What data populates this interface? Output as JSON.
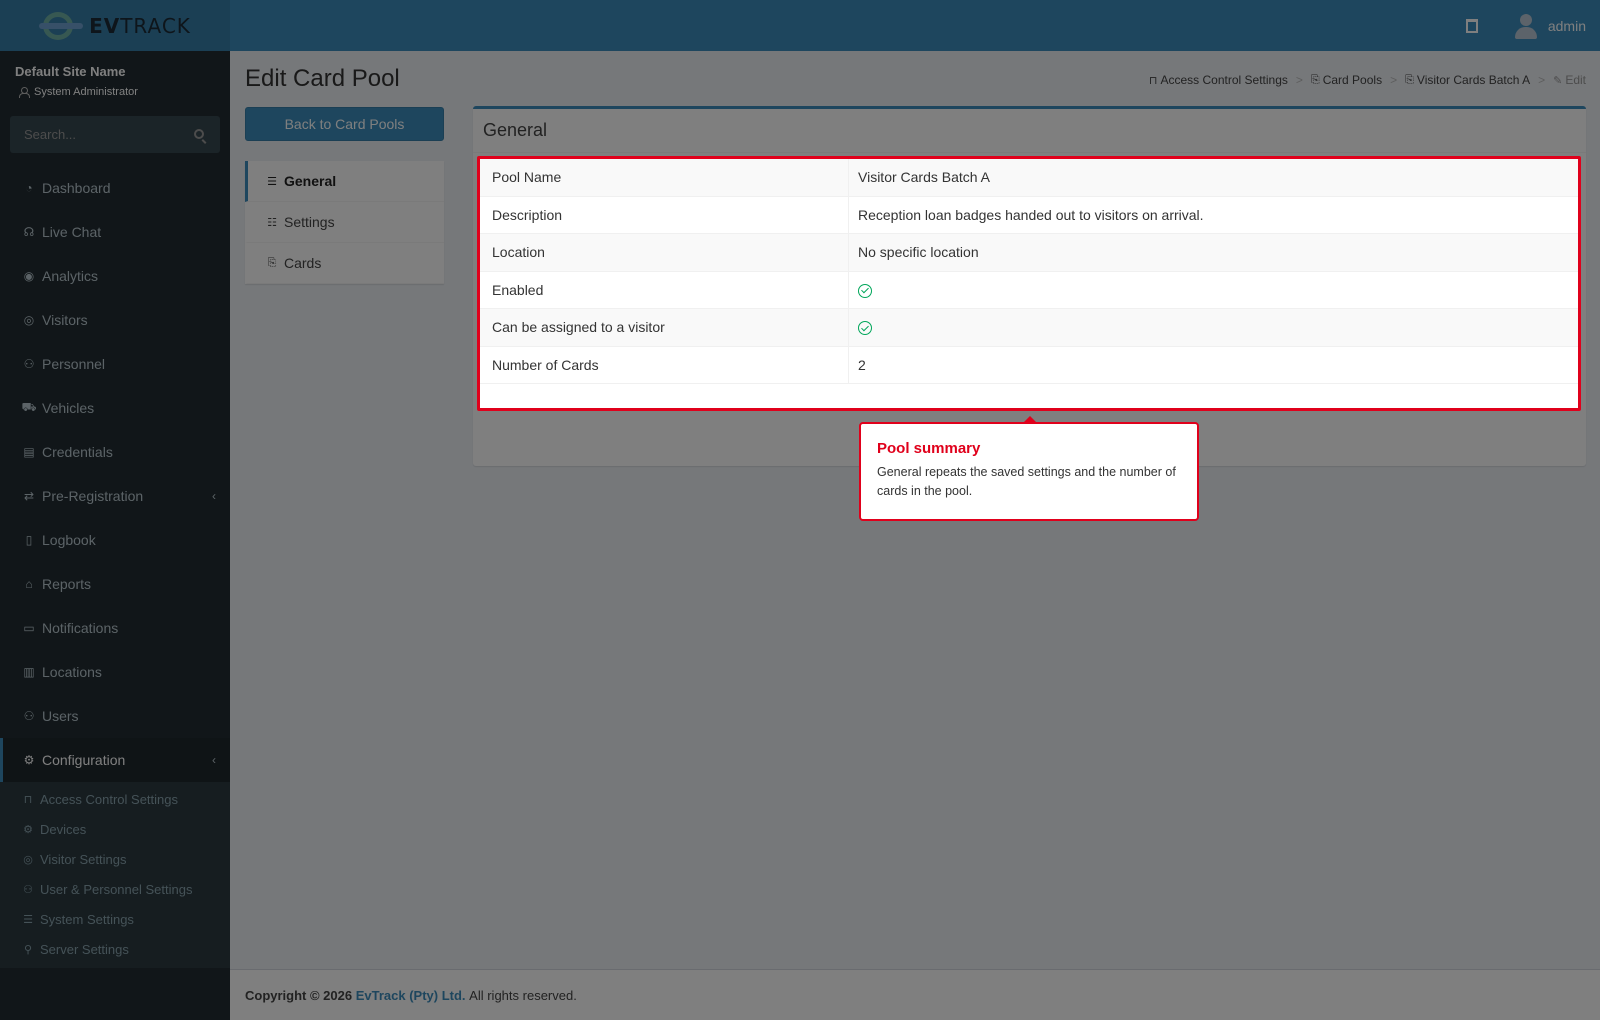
{
  "brand": {
    "name_bold": "EV",
    "name_rest": "TRACK"
  },
  "header": {
    "user_name": "admin"
  },
  "sidebar": {
    "site_name": "Default Site Name",
    "role": "System Administrator",
    "search_placeholder": "Search...",
    "items": [
      {
        "label": "Dashboard",
        "icon": "dashboard-icon",
        "glyph": "◔"
      },
      {
        "label": "Live Chat",
        "icon": "headset-icon",
        "glyph": "☊"
      },
      {
        "label": "Analytics",
        "icon": "analytics-icon",
        "glyph": "◉"
      },
      {
        "label": "Visitors",
        "icon": "eye-icon",
        "glyph": "◎"
      },
      {
        "label": "Personnel",
        "icon": "personnel-icon",
        "glyph": "⚇"
      },
      {
        "label": "Vehicles",
        "icon": "car-icon",
        "glyph": "⛟"
      },
      {
        "label": "Credentials",
        "icon": "id-card-icon",
        "glyph": "▤"
      },
      {
        "label": "Pre-Registration",
        "icon": "arrows-icon",
        "glyph": "⇄"
      },
      {
        "label": "Logbook",
        "icon": "book-icon",
        "glyph": "▯"
      },
      {
        "label": "Reports",
        "icon": "chart-icon",
        "glyph": "⌂"
      },
      {
        "label": "Notifications",
        "icon": "chat-icon",
        "glyph": "▭"
      },
      {
        "label": "Locations",
        "icon": "map-icon",
        "glyph": "▥"
      },
      {
        "label": "Users",
        "icon": "users-icon",
        "glyph": "⚇"
      },
      {
        "label": "Configuration",
        "icon": "gear-icon",
        "glyph": "⚙"
      }
    ],
    "submenu": [
      {
        "label": "Access Control Settings",
        "icon": "lock-icon",
        "glyph": "⊓"
      },
      {
        "label": "Devices",
        "icon": "cog-icon",
        "glyph": "⚙"
      },
      {
        "label": "Visitor Settings",
        "icon": "eye-icon",
        "glyph": "◎"
      },
      {
        "label": "User & Personnel Settings",
        "icon": "users-icon",
        "glyph": "⚇"
      },
      {
        "label": "System Settings",
        "icon": "sliders-icon",
        "glyph": "☰"
      },
      {
        "label": "Server Settings",
        "icon": "server-icon",
        "glyph": "⚲"
      }
    ]
  },
  "page": {
    "title": "Edit Card Pool",
    "back_button": "Back to Card Pools",
    "breadcrumb": [
      {
        "label": "Access Control Settings",
        "icon": "lock-icon",
        "glyph": "⊓"
      },
      {
        "label": "Card Pools",
        "icon": "cards-icon",
        "glyph": "⎘"
      },
      {
        "label": "Visitor Cards Batch A",
        "icon": "cards-icon",
        "glyph": "⎘"
      },
      {
        "label": "Edit",
        "icon": "pencil-icon",
        "glyph": "✎"
      }
    ],
    "tabs": [
      {
        "label": "General",
        "icon": "list-icon",
        "glyph": "☰"
      },
      {
        "label": "Settings",
        "icon": "sliders-icon",
        "glyph": "☷"
      },
      {
        "label": "Cards",
        "icon": "cards-icon",
        "glyph": "⎘"
      }
    ],
    "box_title": "General",
    "details": {
      "pool_name_label": "Pool Name",
      "pool_name_value": "Visitor Cards Batch A",
      "description_label": "Description",
      "description_value": "Reception loan badges handed out to visitors on arrival.",
      "location_label": "Location",
      "location_value": "No specific location",
      "enabled_label": "Enabled",
      "assignable_label": "Can be assigned to a visitor",
      "num_cards_label": "Number of Cards",
      "num_cards_value": "2"
    }
  },
  "callout": {
    "title": "Pool summary",
    "text": "General repeats the saved settings and the number of cards in the pool."
  },
  "footer": {
    "prefix": "Copyright © 2026",
    "company": "EvTrack (Pty) Ltd.",
    "suffix": "All rights reserved."
  },
  "colors": {
    "primary": "#3c8dbc",
    "sidebar_bg": "#222d32",
    "highlight": "#e0001b",
    "success": "#00a65a"
  }
}
